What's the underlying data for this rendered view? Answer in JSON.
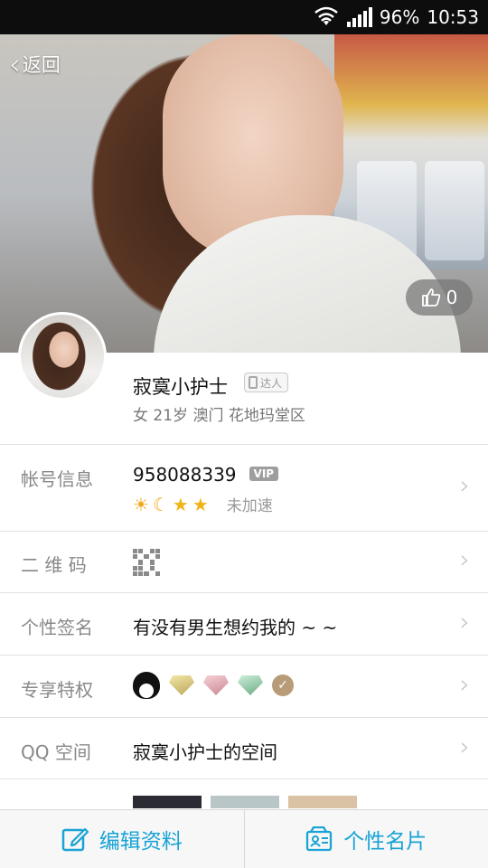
{
  "status_bar": {
    "battery": "96%",
    "time": "10:53"
  },
  "header": {
    "back_label": "返回",
    "like_count": "0"
  },
  "profile": {
    "nickname": "寂寞小护士",
    "badge": "达人",
    "details": "女 21岁 澳门 花地玛堂区"
  },
  "rows": {
    "account": {
      "label": "帐号信息",
      "qq_number": "958088339",
      "vip_badge": "VIP",
      "levels": [
        "☀",
        "☾",
        "★",
        "★"
      ],
      "speed_status": "未加速"
    },
    "qrcode": {
      "label": "二 维 码"
    },
    "signature": {
      "label": "个性签名",
      "value": "有没有男生想约我的 ~ ~"
    },
    "privileges": {
      "label": "专享特权"
    },
    "qzone": {
      "label": "QQ 空间",
      "value": "寂寞小护士的空间"
    }
  },
  "bottom_bar": {
    "edit_label": "编辑资料",
    "card_label": "个性名片"
  },
  "colors": {
    "accent": "#19a3d6",
    "label_gray": "#888888",
    "divider": "#e1e1e1"
  }
}
